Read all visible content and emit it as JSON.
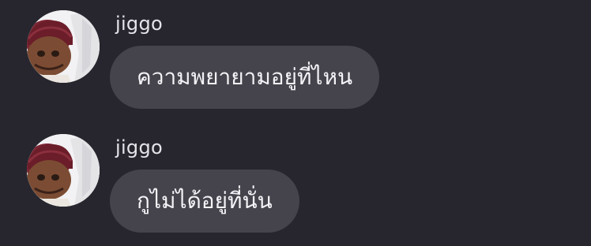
{
  "colors": {
    "background": "#27262e",
    "bubble": "#45444c",
    "username": "#e5e4ea",
    "message_text": "#f4f3f7"
  },
  "messages": [
    {
      "username": "jiggo",
      "text": "ความพยายามอยู่ที่ไหน",
      "avatar_icon": "user-avatar-photo"
    },
    {
      "username": "jiggo",
      "text": "กูไม่ได้อยู่ที่นั่น",
      "avatar_icon": "user-avatar-photo"
    }
  ]
}
